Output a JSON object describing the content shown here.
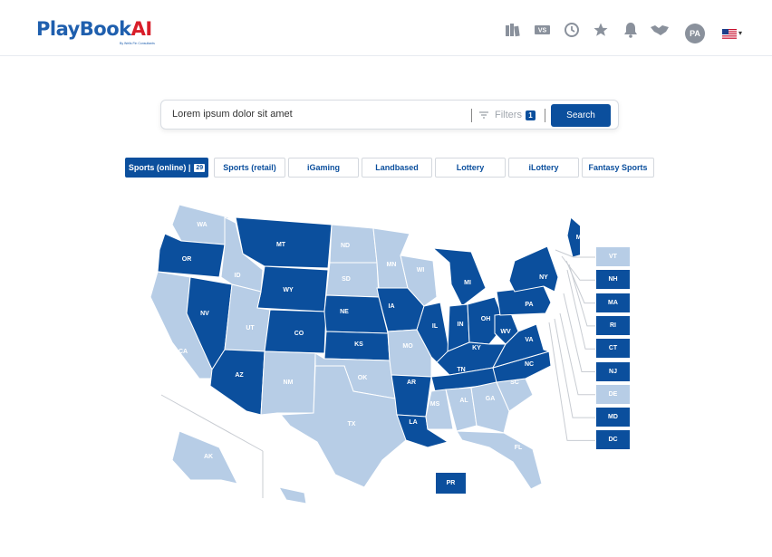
{
  "brand": {
    "name_main": "PlayBook",
    "name_ai": "AI",
    "tagline": "By Wells Fin Consultants"
  },
  "header": {
    "icons": [
      {
        "name": "books-icon"
      },
      {
        "name": "versus-icon"
      },
      {
        "name": "clock-icon"
      },
      {
        "name": "star-icon"
      },
      {
        "name": "bell-icon"
      },
      {
        "name": "handshake-icon"
      }
    ],
    "avatar": "PA",
    "flag": "us-flag-icon"
  },
  "search": {
    "value": "Lorem ipsum dolor sit amet",
    "filters_label": "Filters",
    "filters_count": "1",
    "button": "Search"
  },
  "tabs": [
    {
      "label": "Sports (online)",
      "count": "29",
      "active": true
    },
    {
      "label": "Sports (retail)"
    },
    {
      "label": "iGaming"
    },
    {
      "label": "Landbased"
    },
    {
      "label": "Lottery"
    },
    {
      "label": "iLottery"
    },
    {
      "label": "Fantasy Sports"
    }
  ],
  "colors": {
    "active": "#0b4f9d",
    "inactive": "#b7cde6",
    "brand_red": "#d81e2a"
  },
  "map": {
    "states": [
      {
        "code": "WA",
        "active": false
      },
      {
        "code": "OR",
        "active": true
      },
      {
        "code": "CA",
        "active": false
      },
      {
        "code": "NV",
        "active": true
      },
      {
        "code": "ID",
        "active": false
      },
      {
        "code": "MT",
        "active": true
      },
      {
        "code": "WY",
        "active": true
      },
      {
        "code": "UT",
        "active": false
      },
      {
        "code": "AZ",
        "active": true
      },
      {
        "code": "CO",
        "active": true
      },
      {
        "code": "NM",
        "active": false
      },
      {
        "code": "ND",
        "active": false
      },
      {
        "code": "SD",
        "active": false
      },
      {
        "code": "NE",
        "active": true
      },
      {
        "code": "KS",
        "active": true
      },
      {
        "code": "OK",
        "active": false
      },
      {
        "code": "TX",
        "active": false
      },
      {
        "code": "MN",
        "active": false
      },
      {
        "code": "IA",
        "active": true
      },
      {
        "code": "MO",
        "active": false
      },
      {
        "code": "AR",
        "active": true
      },
      {
        "code": "LA",
        "active": true
      },
      {
        "code": "WI",
        "active": false
      },
      {
        "code": "IL",
        "active": true
      },
      {
        "code": "MI",
        "active": true
      },
      {
        "code": "IN",
        "active": true
      },
      {
        "code": "OH",
        "active": true
      },
      {
        "code": "KY",
        "active": true
      },
      {
        "code": "TN",
        "active": true
      },
      {
        "code": "MS",
        "active": false
      },
      {
        "code": "AL",
        "active": false
      },
      {
        "code": "GA",
        "active": false
      },
      {
        "code": "FL",
        "active": false
      },
      {
        "code": "SC",
        "active": false
      },
      {
        "code": "NC",
        "active": true
      },
      {
        "code": "VA",
        "active": true
      },
      {
        "code": "WV",
        "active": true
      },
      {
        "code": "PA",
        "active": true
      },
      {
        "code": "NY",
        "active": true
      },
      {
        "code": "ME",
        "active": true
      },
      {
        "code": "AK",
        "active": false
      },
      {
        "code": "HI",
        "active": false
      }
    ],
    "side_states": [
      {
        "code": "VT",
        "active": false
      },
      {
        "code": "NH",
        "active": true
      },
      {
        "code": "MA",
        "active": true
      },
      {
        "code": "RI",
        "active": true
      },
      {
        "code": "CT",
        "active": true
      },
      {
        "code": "NJ",
        "active": true
      },
      {
        "code": "DE",
        "active": false
      },
      {
        "code": "MD",
        "active": true
      },
      {
        "code": "DC",
        "active": true
      }
    ],
    "territory": {
      "code": "PR",
      "active": true
    }
  }
}
